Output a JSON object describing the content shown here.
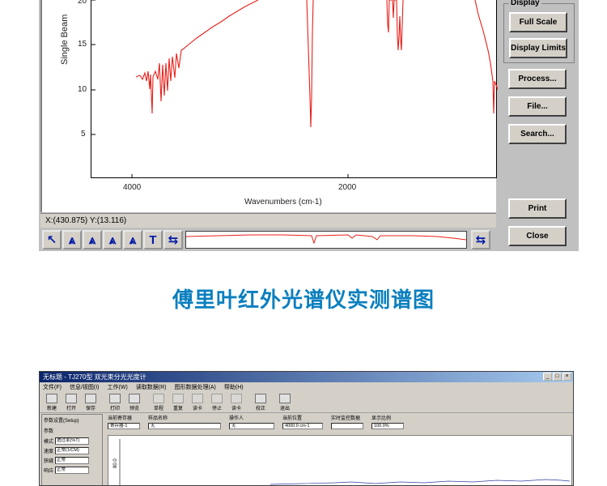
{
  "top": {
    "y_axis_label": "Single Beam",
    "y_ticks": [
      "20",
      "15",
      "10",
      "5"
    ],
    "x_ticks": [
      "4000",
      "2000"
    ],
    "x_axis_label": "Wavenumbers (cm-1)",
    "status_text": "X:(430.875)  Y:(13.116)",
    "display_group_title": "Display",
    "buttons": {
      "full_scale": "Full Scale",
      "display_limits": "Display Limits",
      "process": "Process...",
      "file": "File...",
      "search": "Search...",
      "print": "Print",
      "close": "Close"
    },
    "tools": [
      "↖",
      "⩓",
      "⩓",
      "⩓",
      "⩓",
      "T",
      "⇆"
    ],
    "spectrum_color": "#e8201a"
  },
  "caption": "傅里叶红外光谱仪实测谱图",
  "caption_color": "#0a7fbf",
  "bottom": {
    "title": "无标题 - TJ270型 双光束分光光度计",
    "menus": [
      "文件(F)",
      "信息/视图(I)",
      "工作(W)",
      "读取数据(R)",
      "图形数据处理(A)",
      "帮助(H)"
    ],
    "icons": [
      "新建",
      "打开",
      "保存",
      "打印",
      "预览",
      "单程",
      "重复",
      "读卡",
      "停止",
      "读卡",
      "校正",
      "退出"
    ],
    "param_tab": "参数设置(Setup)",
    "param_group": "参数",
    "params": [
      {
        "label": "模式",
        "value": "透过率(%T)"
      },
      {
        "label": "速度",
        "value": "正常(1/CM)"
      },
      {
        "label": "狭缝",
        "value": "正常"
      },
      {
        "label": "响应",
        "value": "正常"
      }
    ],
    "info": [
      {
        "label": "当前寄存器",
        "value": "寄存器-1"
      },
      {
        "label": "样品名称",
        "value": "无"
      },
      {
        "label": "操作人",
        "value": "无"
      },
      {
        "label": "当前位置",
        "value": "4000.0 cm-1"
      },
      {
        "label": "实时监控数据",
        "value": ""
      },
      {
        "label": "显示比例",
        "value": "100.0%"
      }
    ],
    "chart_y_tick": "80.0"
  }
}
